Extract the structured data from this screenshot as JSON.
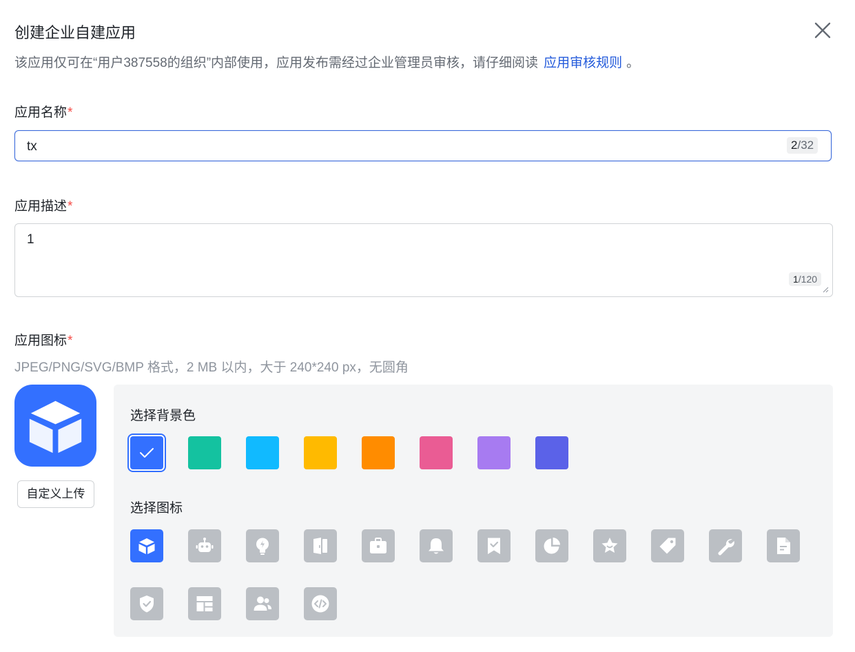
{
  "dialog": {
    "title": "创建企业自建应用",
    "notice": "该应用仅可在“用户387558的组织”内部使用，应用发布需经过企业管理员审核，请仔细阅读",
    "notice_link": "应用审核规则",
    "notice_end": "。"
  },
  "form": {
    "required_mark": "*",
    "name": {
      "label": "应用名称",
      "value": "tx",
      "count_current": "2",
      "count_max": "/32"
    },
    "description": {
      "label": "应用描述",
      "value": "1",
      "count_current": "1",
      "count_max": "/120"
    },
    "icon": {
      "label": "应用图标",
      "hint": "JPEG/PNG/SVG/BMP 格式，2 MB 以内，大于 240*240 px，无圆角",
      "upload_label": "自定义上传",
      "bg_title": "选择背景色",
      "icon_title": "选择图标",
      "selected_color": "#3370ff",
      "colors": [
        "#3370ff",
        "#14c2a0",
        "#11baff",
        "#ffba00",
        "#ff8c00",
        "#ea5c94",
        "#a77bf1",
        "#5b62e8"
      ],
      "icons": [
        "cube-icon",
        "robot-icon",
        "lightbulb-icon",
        "book-icon",
        "briefcase-icon",
        "bell-icon",
        "bookmark-check-icon",
        "pie-chart-icon",
        "star-icon",
        "tag-icon",
        "wrench-icon",
        "document-icon",
        "shield-check-icon",
        "layout-icon",
        "users-icon",
        "code-icon"
      ]
    }
  }
}
